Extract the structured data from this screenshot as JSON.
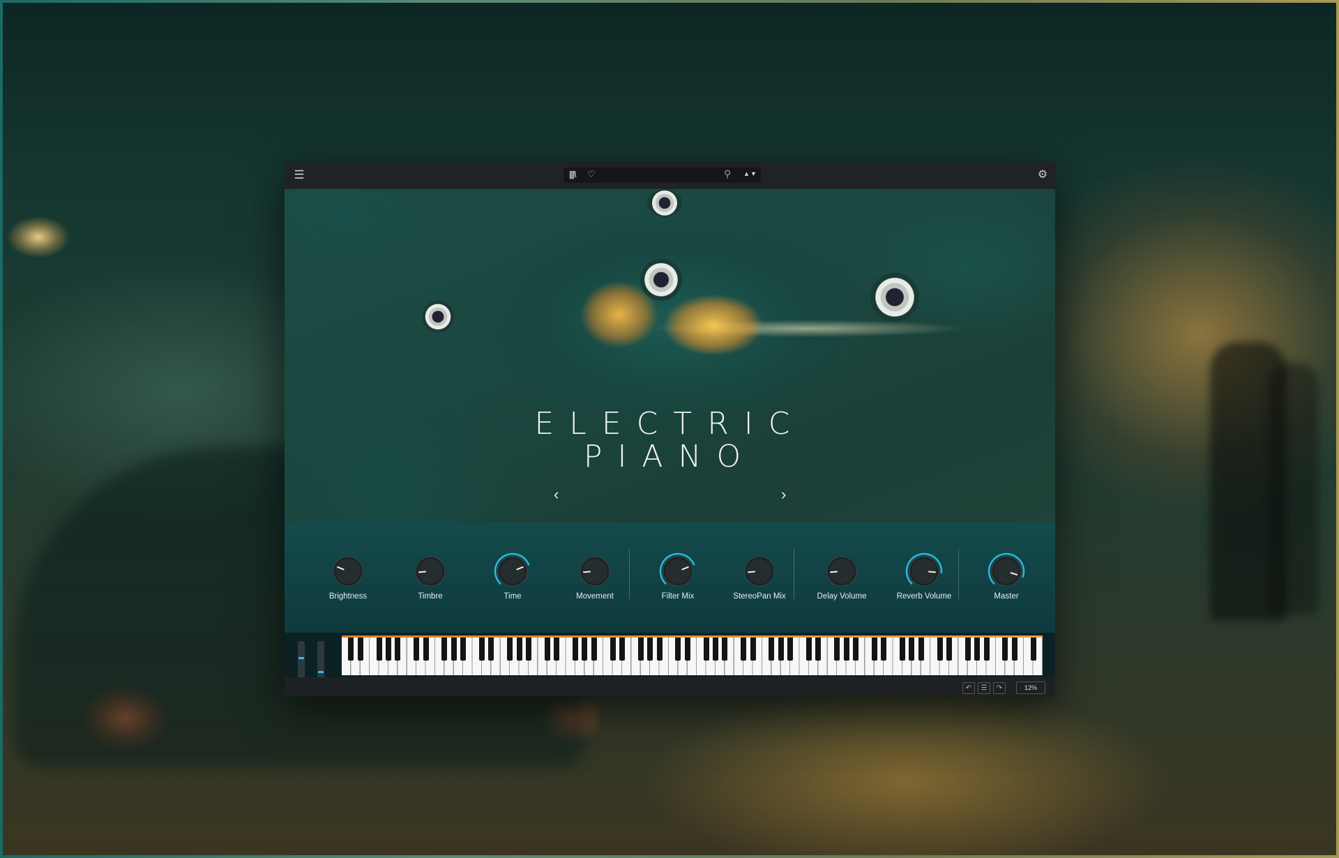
{
  "app": {
    "name": "Electric Piano"
  },
  "header": {
    "menu_icon": "hamburger-icon",
    "library_icon": "library-icon",
    "favorite_icon": "heart-icon",
    "search_icon": "search-icon",
    "prev_preset_glyph": "▲",
    "next_preset_glyph": "▼",
    "settings_icon": "gear-icon",
    "preset_name": ""
  },
  "artwork": {
    "title_line1": "ELECTRIC",
    "title_line2": "PIANO",
    "prev_glyph": "‹",
    "next_glyph": "›"
  },
  "knobs": [
    {
      "label": "Brightness",
      "value": 0.25,
      "active": false
    },
    {
      "label": "Timbre",
      "value": 0.15,
      "active": false
    },
    {
      "label": "Time",
      "value": 0.75,
      "active": true
    },
    {
      "label": "Movement",
      "value": 0.15,
      "active": false
    },
    {
      "label": "Filter Mix",
      "value": 0.75,
      "active": true
    },
    {
      "label": "StereoPan Mix",
      "value": 0.15,
      "active": false
    },
    {
      "label": "Delay Volume",
      "value": 0.15,
      "active": false
    },
    {
      "label": "Reverb Volume",
      "value": 0.85,
      "active": true
    },
    {
      "label": "Master",
      "value": 0.9,
      "active": true
    }
  ],
  "keyboard": {
    "octaves": 10,
    "pitch_wheel": 0.55,
    "mod_wheel": 0.15
  },
  "status": {
    "undo_icon": "undo-icon",
    "history_icon": "history-icon",
    "redo_icon": "redo-icon",
    "zoom": "12%"
  },
  "colors": {
    "accent": "#2fb8d9",
    "panel": "#134547",
    "keyboard_rail": "#e39238"
  }
}
